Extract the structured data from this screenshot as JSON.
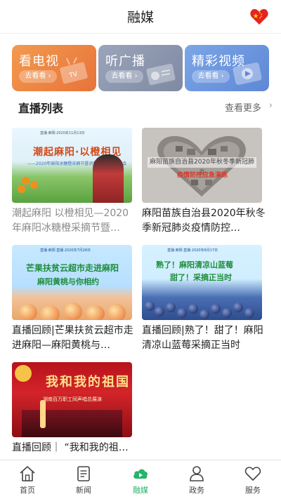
{
  "header": {
    "title": "融媒"
  },
  "cards": [
    {
      "title": "看电视",
      "button": "去看看 ›"
    },
    {
      "title": "听广播",
      "button": "去看看 ›"
    },
    {
      "title": "精彩视频",
      "button": "去看看 ›"
    }
  ],
  "section": {
    "title": "直播列表",
    "more": "查看更多"
  },
  "items": [
    {
      "caption": "潮起麻阳 以橙相见—2020年麻阳冰糖橙采摘节暨…",
      "thumb_title": "潮起麻阳·以橙相见",
      "thumb_sub": "——2020年麻阳冰糖橙采摘节暨消费扶贫产销对接会"
    },
    {
      "caption": "麻阳苗族自治县2020年秋冬季新冠肺炎疫情防控…",
      "thumb_title": "麻阳苗族自治县2020年秋冬季新冠肺炎",
      "thumb_sub": "疫情防控应急演练"
    },
    {
      "caption": "直播回顾|芒果扶贫云超市走进麻阳—麻阳黄桃与…",
      "thumb_title": "芒果扶贫云超市走进麻阳",
      "thumb_sub": "麻阳黄桃与你相约"
    },
    {
      "caption": "直播回顾|熟了！甜了！麻阳清凉山蓝莓采摘正当时",
      "thumb_title": "熟了！麻阳清凉山蓝莓",
      "thumb_sub": "甜了！采摘正当时"
    },
    {
      "caption": "直播回顾｜ “我和我的祖…",
      "thumb_title": "我和我的祖国",
      "thumb_sub": "湖南百万职工同声唱总展演"
    }
  ],
  "nav": [
    {
      "label": "首页",
      "icon": "home-icon"
    },
    {
      "label": "新闻",
      "icon": "news-icon"
    },
    {
      "label": "融媒",
      "icon": "media-cloud-icon",
      "active": true
    },
    {
      "label": "政务",
      "icon": "government-icon"
    },
    {
      "label": "服务",
      "icon": "service-heart-icon"
    }
  ],
  "colors": {
    "active": "#28b36b",
    "tv_card": "#ec8444",
    "radio_card": "#8e98b0",
    "video_card": "#6d95de"
  }
}
